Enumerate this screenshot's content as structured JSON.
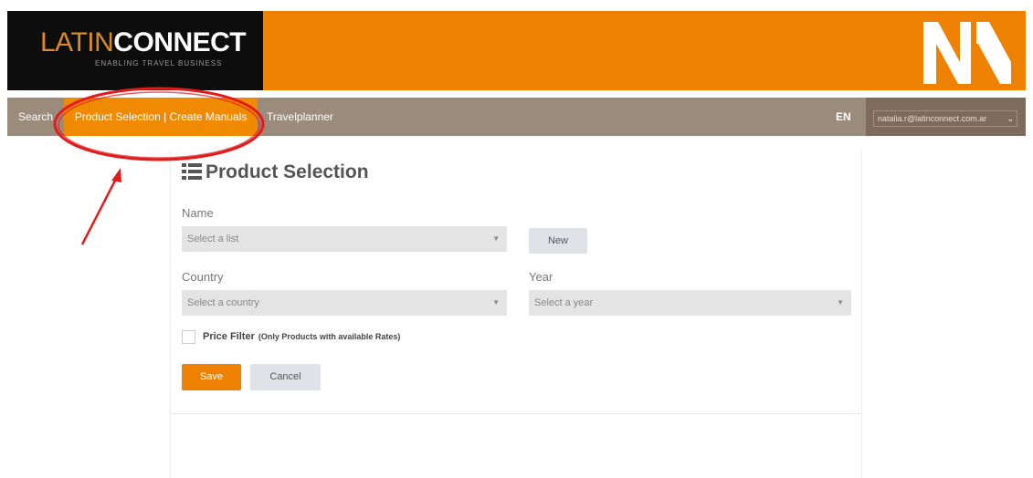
{
  "header": {
    "logo_light": "LATIN",
    "logo_bold": "CONNECT",
    "logo_tagline": "ENABLING TRAVEL BUSINESS",
    "brand_mark_icon": "double-n-logo-icon",
    "colors": {
      "header_orange": "#ee8200",
      "logo_bg": "#0d0d0d",
      "nav_bg": "#9b8b7a",
      "nav_active": "#f08a00"
    }
  },
  "nav": {
    "items": [
      {
        "label": "Search"
      },
      {
        "label": "Product Selection | Create Manuals",
        "active": true
      },
      {
        "label": "Travelplanner"
      }
    ],
    "language": "EN",
    "user_email": "natalia.r@latinconnect.com.ar"
  },
  "main": {
    "title": "Product Selection",
    "title_icon": "list-icon",
    "name_label": "Name",
    "name_select_placeholder": "Select a list",
    "new_button": "New",
    "country_label": "Country",
    "country_select_placeholder": "Select a country",
    "year_label": "Year",
    "year_select_placeholder": "Select a year",
    "price_filter_label": "Price Filter",
    "price_filter_note": "(Only Products with available Rates)",
    "save_button": "Save",
    "cancel_button": "Cancel"
  },
  "annotation": {
    "highlight_color": "#e31b1b"
  }
}
